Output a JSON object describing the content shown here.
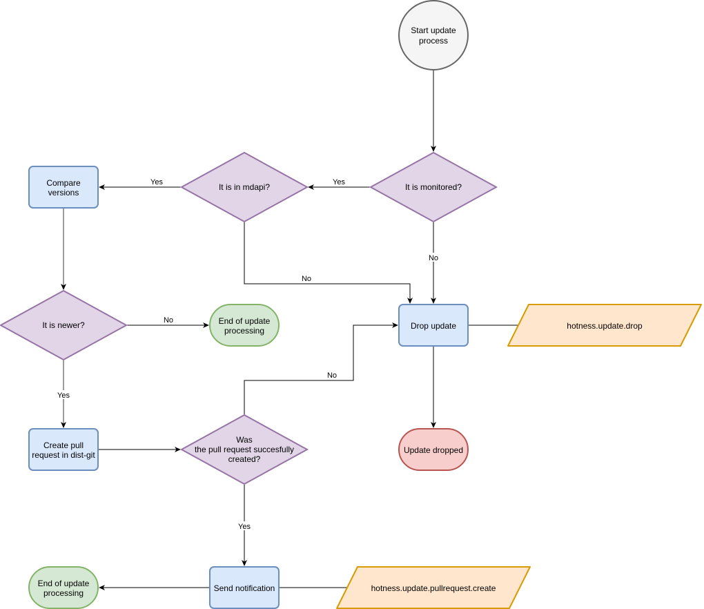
{
  "colors": {
    "start_fill": "#f5f5f5",
    "start_stroke": "#666666",
    "decision_fill": "#e1d5e7",
    "decision_stroke": "#9673a6",
    "process_fill": "#dae8fc",
    "process_stroke": "#6c8ebf",
    "end_fill": "#d5e8d4",
    "end_stroke": "#82b366",
    "dropped_fill": "#f8cecc",
    "dropped_stroke": "#b85450",
    "message_fill": "#ffe6cc",
    "message_stroke": "#d79b00"
  },
  "nodes": {
    "start": [
      "Start update",
      "process"
    ],
    "monitored": [
      "It is monitored?"
    ],
    "mdapi": [
      "It is in mdapi?"
    ],
    "compare": [
      "Compare",
      "versions"
    ],
    "newer": [
      "It is newer?"
    ],
    "end_newer": [
      "End of update",
      "processing"
    ],
    "drop": [
      "Drop update"
    ],
    "drop_msg": [
      "hotness.update.drop"
    ],
    "dropped": [
      "Update dropped"
    ],
    "create_pr": [
      "Create pull",
      "request in dist-git"
    ],
    "pr_created": [
      "Was",
      "the pull request succesfully",
      "created?"
    ],
    "notify": [
      "Send notification"
    ],
    "end_final": [
      "End of update",
      "processing"
    ],
    "pr_msg": [
      "hotness.update.pullrequest.create"
    ]
  },
  "edges": {
    "monitored_yes": "Yes",
    "monitored_no": "No",
    "mdapi_yes": "Yes",
    "mdapi_no": "No",
    "newer_no": "No",
    "newer_yes": "Yes",
    "pr_no": "No",
    "pr_yes": "Yes"
  }
}
